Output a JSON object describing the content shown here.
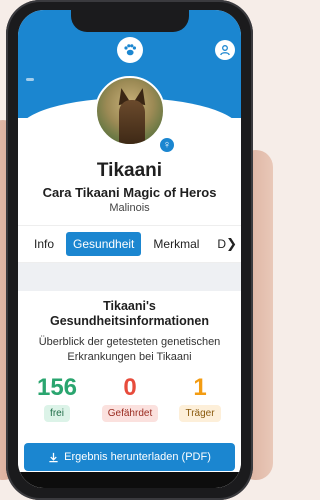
{
  "header": {
    "paw_icon": "paw-icon",
    "user_icon": "user-icon"
  },
  "profile": {
    "name": "Tikaani",
    "full_name": "Cara Tikaani Magic of Heros",
    "breed": "Malinois",
    "gender_symbol": "♀"
  },
  "tabs": [
    {
      "label": "Info"
    },
    {
      "label": "Gesundheit",
      "active": true
    },
    {
      "label": "Merkmal"
    },
    {
      "label": "D"
    }
  ],
  "health": {
    "title_line1": "Tikaani's",
    "title_line2": "Gesundheitsinformationen",
    "description": "Überblick der getesteten genetischen Erkrankungen bei Tikaani",
    "stats": {
      "free": {
        "value": "156",
        "label": "frei"
      },
      "endangered": {
        "value": "0",
        "label": "Gefährdet"
      },
      "carrier": {
        "value": "1",
        "label": "Träger"
      }
    },
    "download_label": "Ergebnis herunterladen (PDF)"
  },
  "colors": {
    "primary": "#1b86d0",
    "free": "#2aa56f",
    "endangered": "#e74c3c",
    "carrier": "#f39c12"
  }
}
